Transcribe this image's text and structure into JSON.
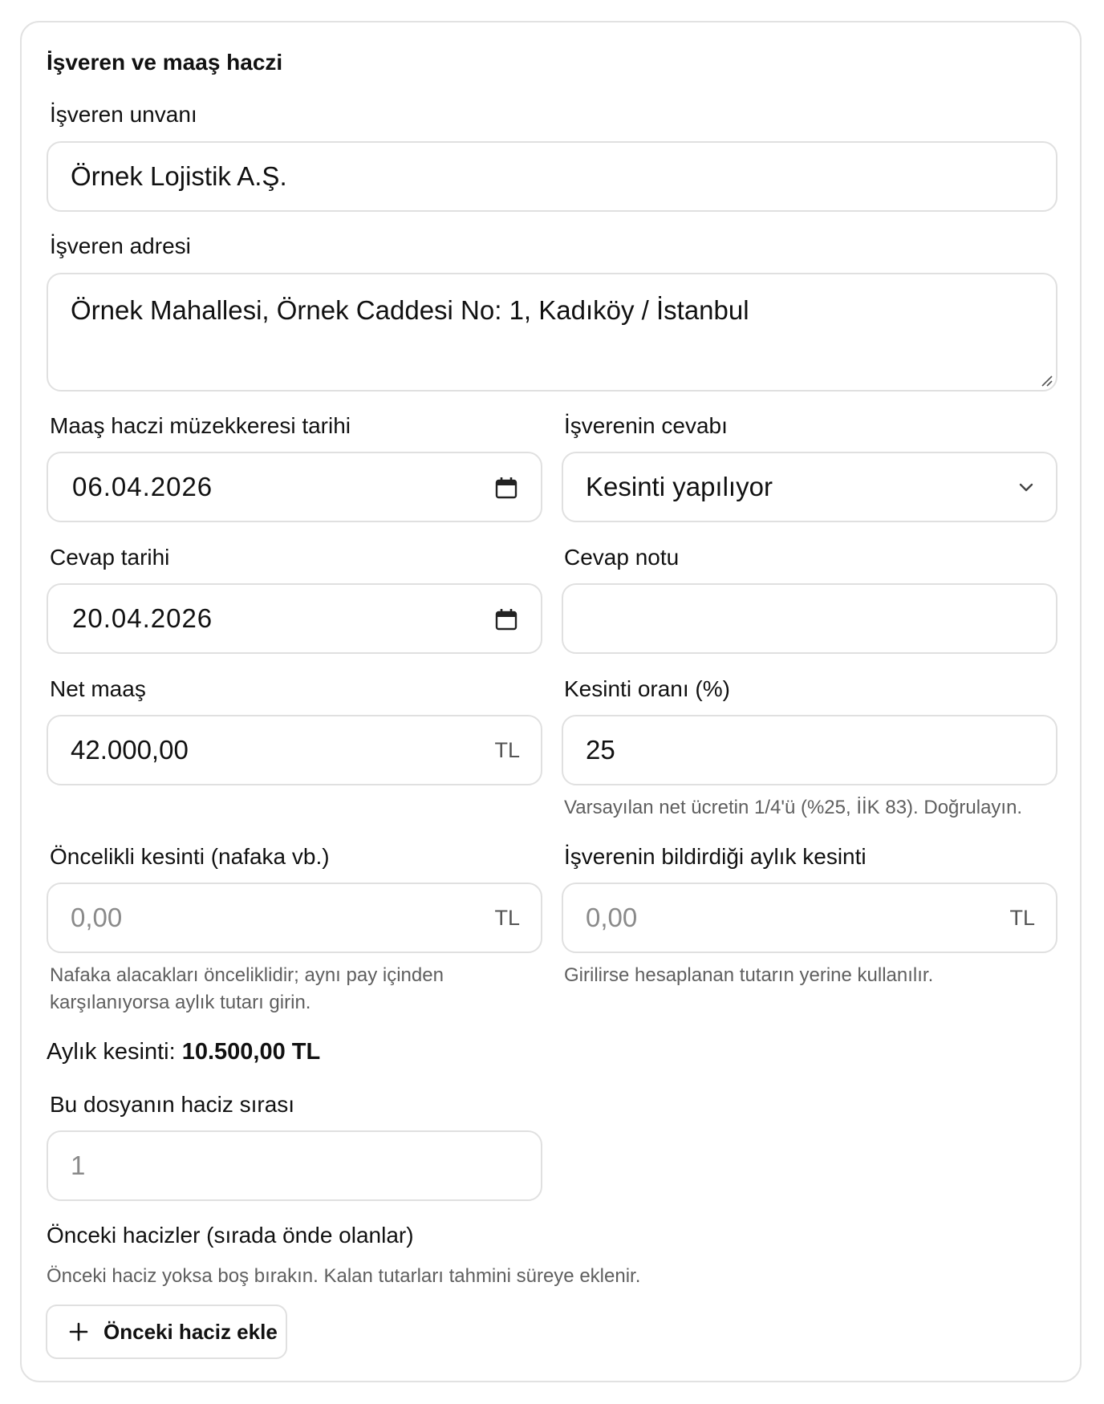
{
  "section": {
    "title": "İşveren ve maaş haczi"
  },
  "employer_name": {
    "label": "İşveren unvanı",
    "value": "Örnek Lojistik A.Ş."
  },
  "employer_address": {
    "label": "İşveren adresi",
    "value": "Örnek Mahallesi, Örnek Caddesi No: 1, Kadıköy / İstanbul"
  },
  "order_date": {
    "label": "Maaş haczi müzekkeresi tarihi",
    "value": "06.04.2026"
  },
  "employer_response": {
    "label": "İşverenin cevabı",
    "selected": "Kesinti yapılıyor"
  },
  "response_date": {
    "label": "Cevap tarihi",
    "value": "20.04.2026"
  },
  "response_note": {
    "label": "Cevap notu",
    "value": ""
  },
  "net_salary": {
    "label": "Net maaş",
    "value": "42.000,00",
    "suffix": "TL"
  },
  "deduction_rate": {
    "label": "Kesinti oranı (%)",
    "value": "25",
    "help": "Varsayılan net ücretin 1/4'ü (%25, İİK 83). Doğrulayın."
  },
  "priority_deduction": {
    "label": "Öncelikli kesinti (nafaka vb.)",
    "placeholder": "0,00",
    "suffix": "TL",
    "help_line1": "Nafaka alacakları önceliklidir; aynı pay içinden",
    "help_line2": "karşılanıyorsa aylık tutarı girin."
  },
  "reported_deduction": {
    "label": "İşverenin bildirdiği aylık kesinti",
    "placeholder": "0,00",
    "suffix": "TL",
    "help": "Girilirse hesaplanan tutarın yerine kullanılır."
  },
  "monthly_deduction": {
    "label": "Aylık kesinti:",
    "value": "10.500,00 TL"
  },
  "seizure_order": {
    "label": "Bu dosyanın haciz sırası",
    "placeholder": "1"
  },
  "previous_seizures": {
    "title": "Önceki hacizler (sırada önde olanlar)",
    "help": "Önceki haciz yoksa boş bırakın. Kalan tutarları tahmini süreye eklenir.",
    "add_button": "Önceki haciz ekle"
  },
  "icons": {
    "date_picker": "calendar-icon",
    "select": "chevron-down-icon",
    "add": "plus-icon"
  }
}
